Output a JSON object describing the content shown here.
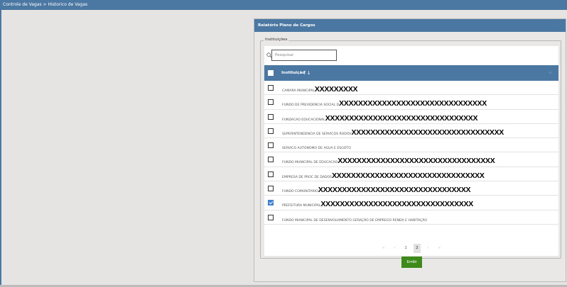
{
  "topbar": {
    "breadcrumb": "Controle de Vagas > Historico de Vagas"
  },
  "panel": {
    "title": "Relatório Plano de Cargos",
    "legend": "Instituições",
    "search": {
      "placeholder": "Pesquisar",
      "value": ""
    },
    "table": {
      "header": {
        "label": "Instituição",
        "sort_glyph": "↑↓",
        "right_glyph": "≡"
      },
      "rows": [
        {
          "name": "CAMARA MUNICIPAL",
          "redacted": "XXXXXXXXX",
          "checked": false
        },
        {
          "name": "FUNDO DE PREVIDENCIA SOCIAL D",
          "redacted": "XXXXXXXXXXXXXXXXXXXXXXXXXXXXXXX",
          "checked": false
        },
        {
          "name": "FUNDACAO EDUCACIONAL",
          "redacted": "XXXXXXXXXXXXXXXXXXXXXXXXXXXXXXXX",
          "checked": false
        },
        {
          "name": "SUPERINTENDENCIA DE SERVICOS RODOV",
          "redacted": "XXXXXXXXXXXXXXXXXXXXXXXXXXXXXXXX",
          "checked": false
        },
        {
          "name": "SERVICO AUTONOMO DE AGUA E ESGOTO",
          "redacted": "",
          "checked": false
        },
        {
          "name": "FUNDO MUNICIPAL DE EDUCACAO",
          "redacted": "XXXXXXXXXXXXXXXXXXXXXXXXXXXXXXXXX",
          "checked": false
        },
        {
          "name": "EMPRESA DE PROC DE DADOS",
          "redacted": "XXXXXXXXXXXXXXXXXXXXXXXXXXXXXXXX",
          "checked": false
        },
        {
          "name": "FUNDO COMUNITARIO",
          "redacted": "XXXXXXXXXXXXXXXXXXXXXXXXXXXXXXXX",
          "checked": false
        },
        {
          "name": "PREFEITURA MUNICIPAL",
          "redacted": "XXXXXXXXXXXXXXXXXXXXXXXXXXXXXXXX",
          "checked": true
        },
        {
          "name": "FUNDO MUNICIPAL DE DESENVOLVIMENTO GERAÇÃO DE EMPREGO RENDA E HABITAÇÃO",
          "redacted": "",
          "checked": false
        }
      ]
    },
    "pagination": {
      "first": "«",
      "prev": "‹",
      "pages": [
        "1",
        "2"
      ],
      "current": "2",
      "next": "›",
      "last": "»"
    }
  },
  "actions": {
    "emit_label": "Emitir"
  },
  "colors": {
    "header_blue": "#4a78a3",
    "emit_green": "#3d8a1a",
    "checkbox_checked": "#3a83d9"
  },
  "icons": {
    "search": "search-icon",
    "sort": "sort-icon",
    "checkbox": "checkbox"
  }
}
